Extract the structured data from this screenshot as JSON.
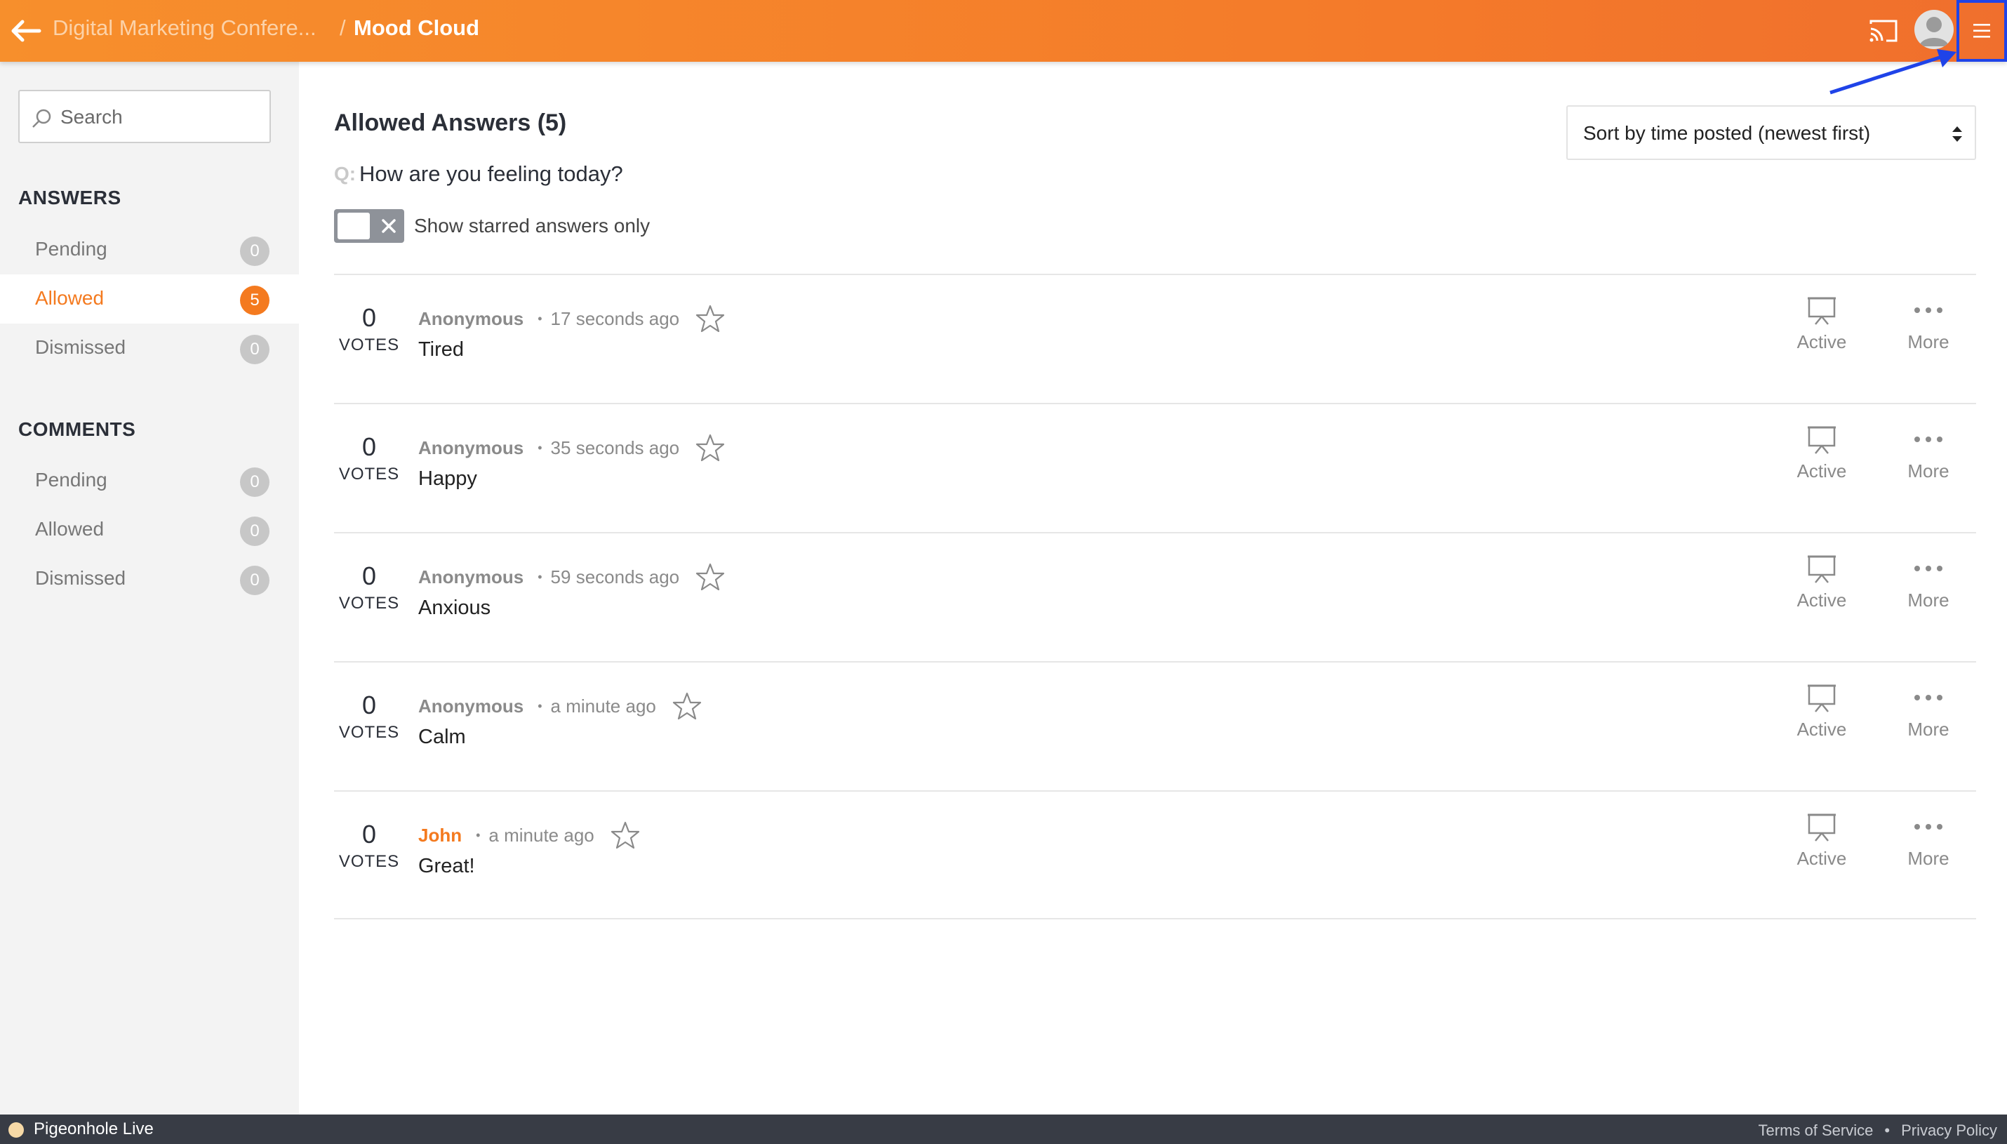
{
  "header": {
    "breadcrumb_parent": "Digital Marketing Confere...",
    "breadcrumb_separator": "/",
    "breadcrumb_current": "Mood Cloud",
    "accent_color": "#f47a2a"
  },
  "sidebar": {
    "search_placeholder": "Search",
    "answers_title": "ANSWERS",
    "answers": [
      {
        "label": "Pending",
        "count": "0"
      },
      {
        "label": "Allowed",
        "count": "5"
      },
      {
        "label": "Dismissed",
        "count": "0"
      }
    ],
    "comments_title": "COMMENTS",
    "comments": [
      {
        "label": "Pending",
        "count": "0"
      },
      {
        "label": "Allowed",
        "count": "0"
      },
      {
        "label": "Dismissed",
        "count": "0"
      }
    ]
  },
  "main": {
    "title": "Allowed Answers (5)",
    "question_prefix": "Q:",
    "question": "How are you feeling today?",
    "toggle_label": "Show starred answers only",
    "sort_selected": "Sort by time posted (newest first)",
    "votes_label": "VOTES",
    "active_label": "Active",
    "more_label": "More",
    "answers": [
      {
        "votes": "0",
        "author": "Anonymous",
        "time": "17 seconds ago",
        "text": "Tired"
      },
      {
        "votes": "0",
        "author": "Anonymous",
        "time": "35 seconds ago",
        "text": "Happy"
      },
      {
        "votes": "0",
        "author": "Anonymous",
        "time": "59 seconds ago",
        "text": "Anxious"
      },
      {
        "votes": "0",
        "author": "Anonymous",
        "time": "a minute ago",
        "text": "Calm"
      },
      {
        "votes": "0",
        "author": "John",
        "time": "a minute ago",
        "text": "Great!"
      }
    ]
  },
  "footer": {
    "brand": "Pigeonhole Live",
    "terms": "Terms of Service",
    "separator": "•",
    "privacy": "Privacy Policy"
  }
}
